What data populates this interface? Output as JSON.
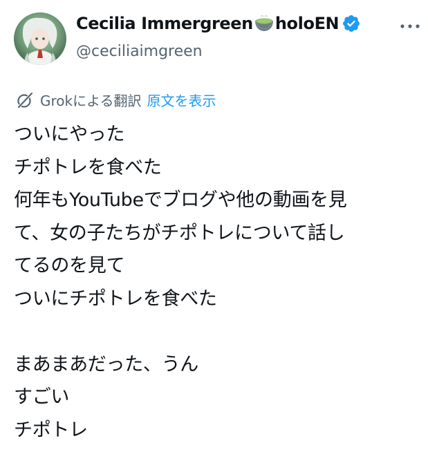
{
  "author": {
    "display_name": "Cecilia Immergreen",
    "name_suffix": "holoEN",
    "emoji_icon": "matcha-bowl-icon",
    "verified_icon": "verified-badge-icon",
    "handle": "@ceciliaimgreen"
  },
  "menu": {
    "more_icon": "more-options-icon",
    "more_label": "⋯"
  },
  "translation": {
    "icon": "grok-icon",
    "label": "Grokによる翻訳",
    "show_original": "原文を表示"
  },
  "tweet": {
    "lines": [
      "ついにやった",
      "チポトレを食べた",
      "何年もYouTubeでブログや他の動画を見",
      "て、女の子たちがチポトレについて話し",
      "てるのを見て",
      "ついにチポトレを食べた",
      "",
      "まあまあだった、うん",
      "すごい",
      "チポトレ"
    ]
  },
  "colors": {
    "text": "#0f1419",
    "secondary": "#536471",
    "link": "#1d9bf0",
    "verified": "#1d9bf0",
    "avatar_bg": "#6f8f6a"
  }
}
